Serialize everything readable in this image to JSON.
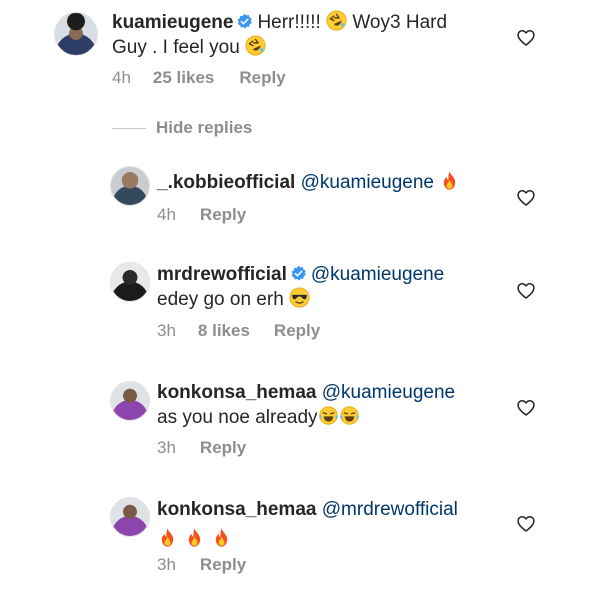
{
  "comments": [
    {
      "username": "kuamieugene",
      "verified": true,
      "text_line1": "Herr!!!!!",
      "text_line1b": "Woy3 Hard",
      "text_line2": "Guy . I feel you",
      "time": "4h",
      "likes": "25 likes",
      "reply": "Reply"
    },
    {
      "username": "_.kobbieofficial",
      "mention": "@kuamieugene",
      "time": "4h",
      "reply": "Reply"
    },
    {
      "username": "mrdrewofficial",
      "verified": true,
      "mention": "@kuamieugene",
      "text_line2": "edey go on erh",
      "time": "3h",
      "likes": "8 likes",
      "reply": "Reply"
    },
    {
      "username": "konkonsa_hemaa",
      "mention": "@kuamieugene",
      "text_line2": "as you noe already",
      "time": "3h",
      "reply": "Reply"
    },
    {
      "username": "konkonsa_hemaa",
      "mention": "@mrdrewofficial",
      "time": "3h",
      "reply": "Reply"
    }
  ],
  "hide_replies_label": "Hide replies",
  "icons": {
    "emoji_rofl": "rolling-on-floor-laughing",
    "emoji_fire": "fire",
    "emoji_sunglasses": "smiling-face-with-sunglasses",
    "emoji_tears": "face-with-tears-of-joy",
    "verified": "verified-badge",
    "like": "heart-outline"
  },
  "colors": {
    "verified_blue": "#3897f0",
    "mention_blue": "#00376b",
    "meta_gray": "#8e8e8e"
  }
}
